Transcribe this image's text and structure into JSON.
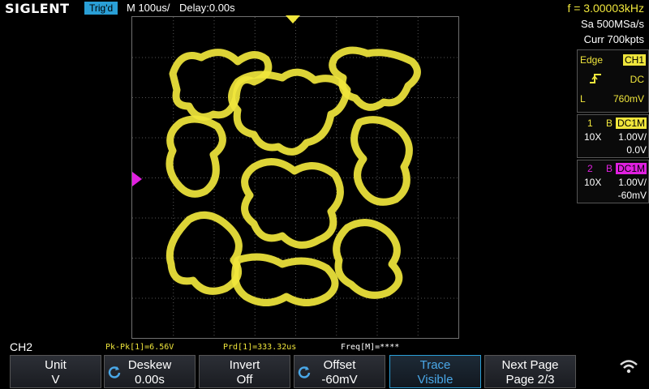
{
  "header": {
    "brand": "SIGLENT",
    "trigger_status": "Trig'd",
    "timebase": "M 100us/",
    "delay": "Delay:0.00s",
    "frequency": "f = 3.00003kHz"
  },
  "acquisition": {
    "sample_rate": "Sa 500MSa/s",
    "memory_depth": "Curr 700kpts"
  },
  "trigger_panel": {
    "type": "Edge",
    "source": "CH1",
    "coupling": "DC",
    "level_label": "L",
    "level": "760mV"
  },
  "channels": [
    {
      "number": "1",
      "bw_flag": "B",
      "coupling": "DC1M",
      "probe": "10X",
      "scale": "1.00V/",
      "offset": "0.0V",
      "color": "#f0e63c"
    },
    {
      "number": "2",
      "bw_flag": "B",
      "coupling": "DC1M",
      "probe": "10X",
      "scale": "1.00V/",
      "offset": "-60mV",
      "color": "#e020e0"
    }
  ],
  "measurements": {
    "active_channel": "CH2",
    "pk_pk": "Pk-Pk[1]=6.56V",
    "period": "Prd[1]=333.32us",
    "freq": "Freq[M]=****"
  },
  "softkeys": [
    {
      "label": "Unit",
      "value": "V",
      "knob": false
    },
    {
      "label": "Deskew",
      "value": "0.00s",
      "knob": true
    },
    {
      "label": "Invert",
      "value": "Off",
      "knob": false
    },
    {
      "label": "Offset",
      "value": "-60mV",
      "knob": true
    },
    {
      "label": "Trace",
      "value": "Visible",
      "knob": false,
      "active": true
    },
    {
      "label": "Next Page",
      "value": "Page 2/3",
      "knob": false
    }
  ],
  "icons": {
    "wifi": "wifi-icon",
    "knob": "adjust-knob-icon",
    "trigger_edge": "rising-edge-icon"
  },
  "colors": {
    "ch1": "#f0e63c",
    "ch2": "#e020e0",
    "accent": "#2a9fd6"
  }
}
